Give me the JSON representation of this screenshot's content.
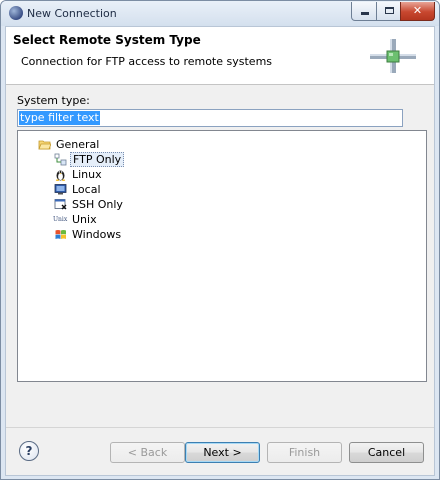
{
  "window": {
    "title": "New Connection"
  },
  "header": {
    "title": "Select Remote System Type",
    "description": "Connection for FTP access to remote systems"
  },
  "filter": {
    "label": "System type:",
    "placeholder": "type filter text"
  },
  "tree": {
    "group_label": "General",
    "items": [
      {
        "label": "FTP Only",
        "icon": "ftp-icon",
        "selected": true
      },
      {
        "label": "Linux",
        "icon": "linux-penguin-icon",
        "selected": false
      },
      {
        "label": "Local",
        "icon": "local-monitor-icon",
        "selected": false
      },
      {
        "label": "SSH Only",
        "icon": "ssh-icon",
        "selected": false
      },
      {
        "label": "Unix",
        "icon": "unix-icon",
        "selected": false
      },
      {
        "label": "Windows",
        "icon": "windows-icon",
        "selected": false
      }
    ]
  },
  "unix_icon_text": "Unix",
  "buttons": {
    "help": "?",
    "back": "< Back",
    "next": "Next >",
    "finish": "Finish",
    "cancel": "Cancel"
  },
  "colors": {
    "selection": "#3399ff",
    "title_bar": "#dce6f2"
  }
}
